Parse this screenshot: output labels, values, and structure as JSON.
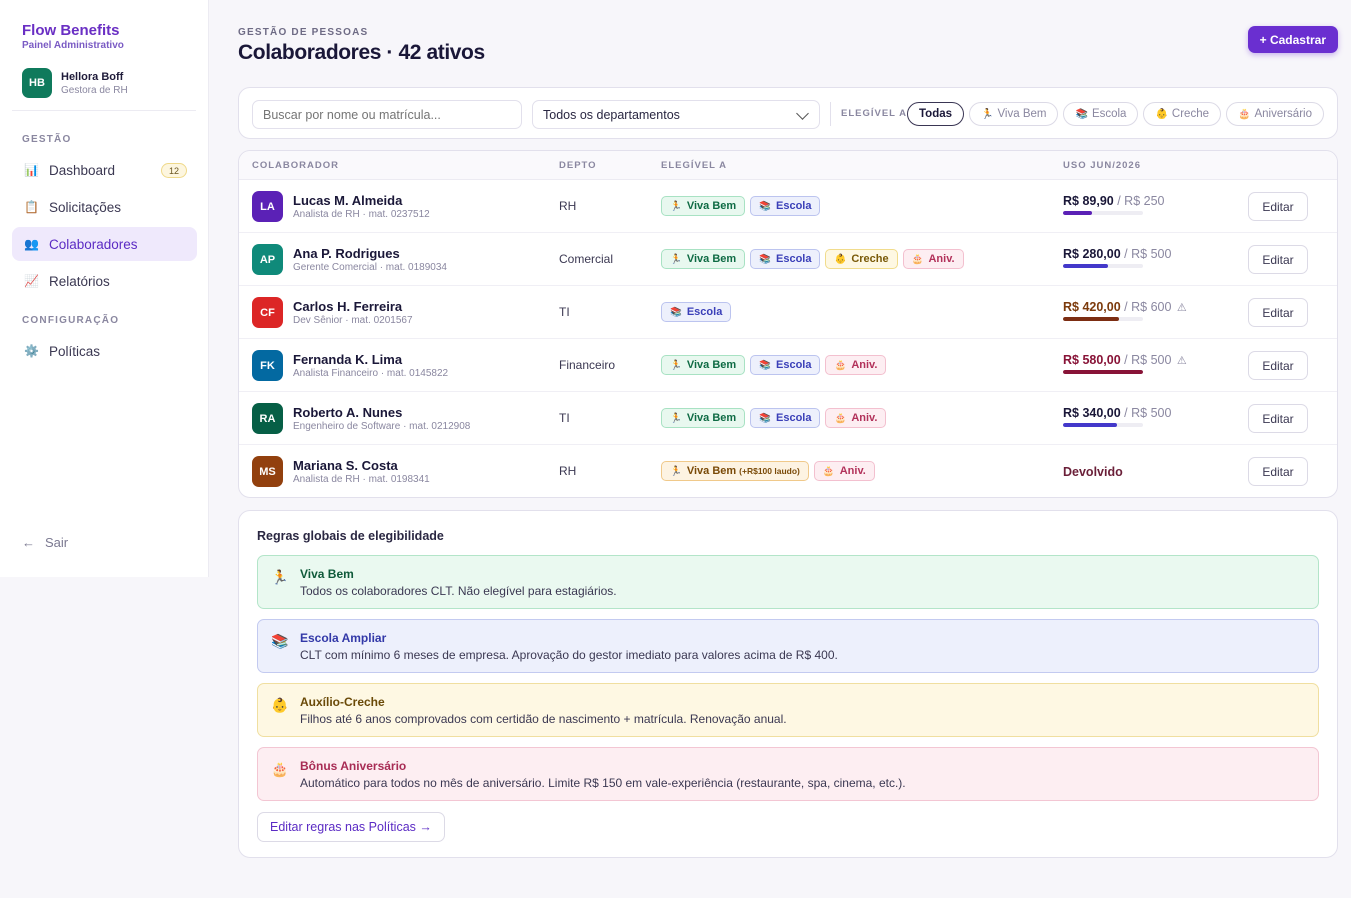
{
  "app": {
    "brand": "Flow Benefits",
    "subtitle": "Painel Administrativo"
  },
  "user": {
    "initials": "HB",
    "name": "Hellora Boff",
    "role": "Gestora de RH",
    "color": "#0f7a5c"
  },
  "sidebar": {
    "section_gestao": "GESTÃO",
    "section_config": "CONFIGURAÇÃO",
    "items": [
      {
        "icon": "📊",
        "label": "Dashboard",
        "badge": "12"
      },
      {
        "icon": "📋",
        "label": "Solicitações"
      },
      {
        "icon": "👥",
        "label": "Colaboradores"
      },
      {
        "icon": "📈",
        "label": "Relatórios"
      },
      {
        "icon": "⚙️",
        "label": "Políticas"
      }
    ],
    "logout": "Sair",
    "logout_icon": "←"
  },
  "header": {
    "eyebrow": "GESTÃO DE PESSOAS",
    "title": "Colaboradores · 42 ativos",
    "primary_button": "+ Cadastrar"
  },
  "filters": {
    "search_placeholder": "Buscar por nome ou matrícula...",
    "department_value": "Todos os departamentos",
    "eligible_label": "ELEGÍVEL A",
    "chips": [
      {
        "icon": "",
        "label": "Todas"
      },
      {
        "icon": "🏃",
        "label": "Viva Bem"
      },
      {
        "icon": "📚",
        "label": "Escola"
      },
      {
        "icon": "👶",
        "label": "Creche"
      },
      {
        "icon": "🎂",
        "label": "Aniversário"
      }
    ]
  },
  "table": {
    "headers": {
      "colaborador": "COLABORADOR",
      "depto": "DEPTO",
      "elegivel": "ELEGÍVEL A",
      "uso": "USO JUN/2026"
    },
    "edit_label": "Editar",
    "rows": [
      {
        "initials": "LA",
        "color": "#5b21b6",
        "name": "Lucas M. Almeida",
        "sub": "Analista de RH · mat. 0237512",
        "dept": "RH",
        "tags": [
          {
            "kind": "vivabem",
            "icon": "🏃",
            "label": "Viva Bem"
          },
          {
            "kind": "escola",
            "icon": "📚",
            "label": "Escola"
          }
        ],
        "used": "R$ 89,90",
        "limit": "/ R$ 250",
        "fraction": 0.36,
        "bar_color": "#5b21b6",
        "value_color": "#1a1738"
      },
      {
        "initials": "AP",
        "color": "#0f8a7a",
        "name": "Ana P. Rodrigues",
        "sub": "Gerente Comercial · mat. 0189034",
        "dept": "Comercial",
        "tags": [
          {
            "kind": "vivabem",
            "icon": "🏃",
            "label": "Viva Bem"
          },
          {
            "kind": "escola",
            "icon": "📚",
            "label": "Escola"
          },
          {
            "kind": "creche",
            "icon": "👶",
            "label": "Creche"
          },
          {
            "kind": "aniv",
            "icon": "🎂",
            "label": "Aniv."
          }
        ],
        "used": "R$ 280,00",
        "limit": "/ R$ 500",
        "fraction": 0.56,
        "bar_color": "#4338ca",
        "value_color": "#1a1738"
      },
      {
        "initials": "CF",
        "color": "#dc2626",
        "name": "Carlos H. Ferreira",
        "sub": "Dev Sênior · mat. 0201567",
        "dept": "TI",
        "tags": [
          {
            "kind": "escola",
            "icon": "📚",
            "label": "Escola"
          }
        ],
        "used": "R$ 420,00",
        "limit": "/ R$ 600",
        "warn": "⚠",
        "fraction": 0.7,
        "bar_color": "#7c2d12",
        "value_color": "#7c3a0c"
      },
      {
        "initials": "FK",
        "color": "#0369a1",
        "name": "Fernanda K. Lima",
        "sub": "Analista Financeiro · mat. 0145822",
        "dept": "Financeiro",
        "tags": [
          {
            "kind": "vivabem",
            "icon": "🏃",
            "label": "Viva Bem"
          },
          {
            "kind": "escola",
            "icon": "📚",
            "label": "Escola"
          },
          {
            "kind": "aniv",
            "icon": "🎂",
            "label": "Aniv."
          }
        ],
        "used": "R$ 580,00",
        "limit": "/ R$ 500",
        "warn": "⚠",
        "fraction": 1.0,
        "bar_color": "#881337",
        "value_color": "#881337"
      },
      {
        "initials": "RA",
        "color": "#065f46",
        "name": "Roberto A. Nunes",
        "sub": "Engenheiro de Software · mat. 0212908",
        "dept": "TI",
        "tags": [
          {
            "kind": "vivabem",
            "icon": "🏃",
            "label": "Viva Bem"
          },
          {
            "kind": "escola",
            "icon": "📚",
            "label": "Escola"
          },
          {
            "kind": "aniv",
            "icon": "🎂",
            "label": "Aniv."
          }
        ],
        "used": "R$ 340,00",
        "limit": "/ R$ 500",
        "fraction": 0.68,
        "bar_color": "#4338ca",
        "value_color": "#1a1738"
      },
      {
        "initials": "MS",
        "color": "#92400e",
        "name": "Mariana S. Costa",
        "sub": "Analista de RH · mat. 0198341",
        "dept": "RH",
        "tags": [
          {
            "kind": "warn",
            "icon": "🏃",
            "label": "Viva Bem",
            "note": "(+R$100 laudo)"
          },
          {
            "kind": "aniv",
            "icon": "🎂",
            "label": "Aniv."
          }
        ],
        "status": "Devolvido"
      }
    ]
  },
  "rules": {
    "title": "Regras globais de elegibilidade",
    "items": [
      {
        "kind": "vivabem",
        "icon": "🏃",
        "title": "Viva Bem",
        "desc": "Todos os colaboradores CLT. Não elegível para estagiários."
      },
      {
        "kind": "escola",
        "icon": "📚",
        "title": "Escola Ampliar",
        "desc": "CLT com mínimo 6 meses de empresa. Aprovação do gestor imediato para valores acima de R$ 400."
      },
      {
        "kind": "creche",
        "icon": "👶",
        "title": "Auxílio-Creche",
        "desc": "Filhos até 6 anos comprovados com certidão de nascimento + matrícula. Renovação anual."
      },
      {
        "kind": "aniv",
        "icon": "🎂",
        "title": "Bônus Aniversário",
        "desc": "Automático para todos no mês de aniversário. Limite R$ 150 em vale-experiência (restaurante, spa, cinema, etc.)."
      }
    ],
    "link": "Editar regras nas Políticas →"
  }
}
